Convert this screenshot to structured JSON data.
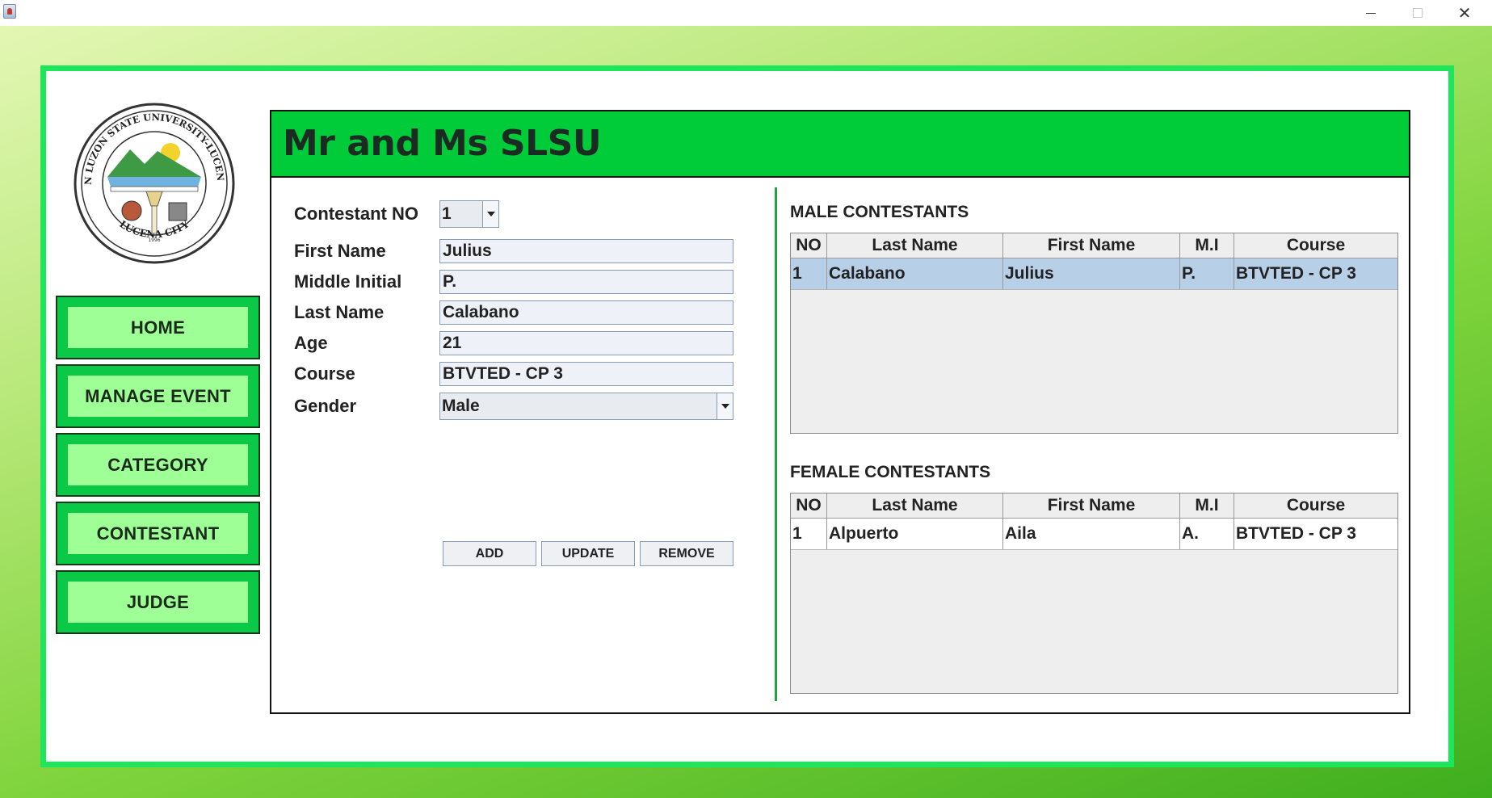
{
  "nav": {
    "items": [
      {
        "label": "HOME"
      },
      {
        "label": "MANAGE EVENT"
      },
      {
        "label": "CATEGORY"
      },
      {
        "label": "CONTESTANT"
      },
      {
        "label": "JUDGE"
      }
    ]
  },
  "logo": {
    "text_top": "SOUTHERN LUZON STATE UNIVERSITY-LUCENA CAMPUS",
    "text_bottom": "LUCENA CITY",
    "year": "1996"
  },
  "header": {
    "title": "Mr and Ms SLSU"
  },
  "form": {
    "contestant_no_label": "Contestant NO",
    "contestant_no_value": "1",
    "first_name_label": "First Name",
    "first_name_value": "Julius",
    "middle_initial_label": "Middle Initial",
    "middle_initial_value": "P.",
    "last_name_label": "Last Name",
    "last_name_value": "Calabano",
    "age_label": "Age",
    "age_value": "21",
    "course_label": "Course",
    "course_value": "BTVTED - CP 3",
    "gender_label": "Gender",
    "gender_value": "Male"
  },
  "actions": {
    "add": "ADD",
    "update": "UPDATE",
    "remove": "REMOVE"
  },
  "male_table": {
    "title": "MALE CONTESTANTS",
    "columns": [
      "NO",
      "Last Name",
      "First Name",
      "M.I",
      "Course"
    ],
    "rows": [
      [
        "1",
        "Calabano",
        "Julius",
        "P.",
        "BTVTED - CP 3"
      ]
    ]
  },
  "female_table": {
    "title": "FEMALE CONTESTANTS",
    "columns": [
      "NO",
      "Last Name",
      "First Name",
      "M.I",
      "Course"
    ],
    "rows": [
      [
        "1",
        "Alpuerto",
        "Aila",
        "A.",
        "BTVTED - CP 3"
      ]
    ]
  },
  "colors": {
    "frame_border": "#1ee65a",
    "header_green": "#00cc3a",
    "nav_outer": "#0ac947",
    "nav_inner": "#9dff96",
    "selected_row": "#b8cfe8"
  }
}
